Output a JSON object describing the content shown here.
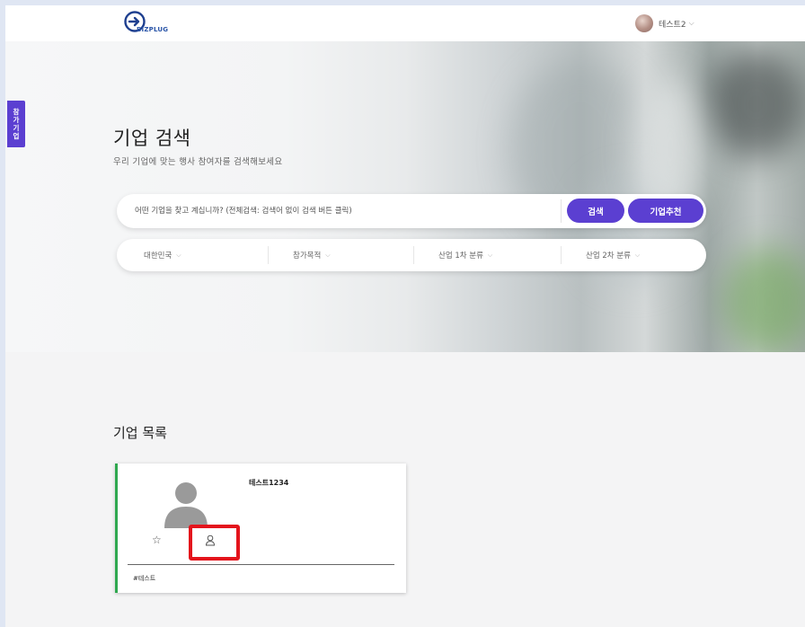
{
  "header": {
    "logo_text": "BIZPLUG",
    "user_name": "테스트2"
  },
  "side_tab": {
    "label_chars": [
      "참",
      "가",
      "기",
      "업"
    ]
  },
  "hero": {
    "title": "기업 검색",
    "subtitle": "우리 기업에 맞는 행사 참여자를 검색해보세요",
    "search_placeholder": "어떤 기업을 찾고 계십니까? (전체검색: 검색어 없이 검색 버튼 클릭)",
    "search_button": "검색",
    "recommend_button": "기업추천",
    "filters": [
      {
        "label": "대한민국"
      },
      {
        "label": "참가목적"
      },
      {
        "label": "산업 1차 분류"
      },
      {
        "label": "산업 2차 분류"
      }
    ]
  },
  "company_list": {
    "title": "기업 목록",
    "cards": [
      {
        "name": "테스트1234",
        "tag": "#테스트"
      }
    ]
  },
  "colors": {
    "accent": "#5b3fd1",
    "card_border": "#2fa84f",
    "highlight": "#e4141c"
  }
}
